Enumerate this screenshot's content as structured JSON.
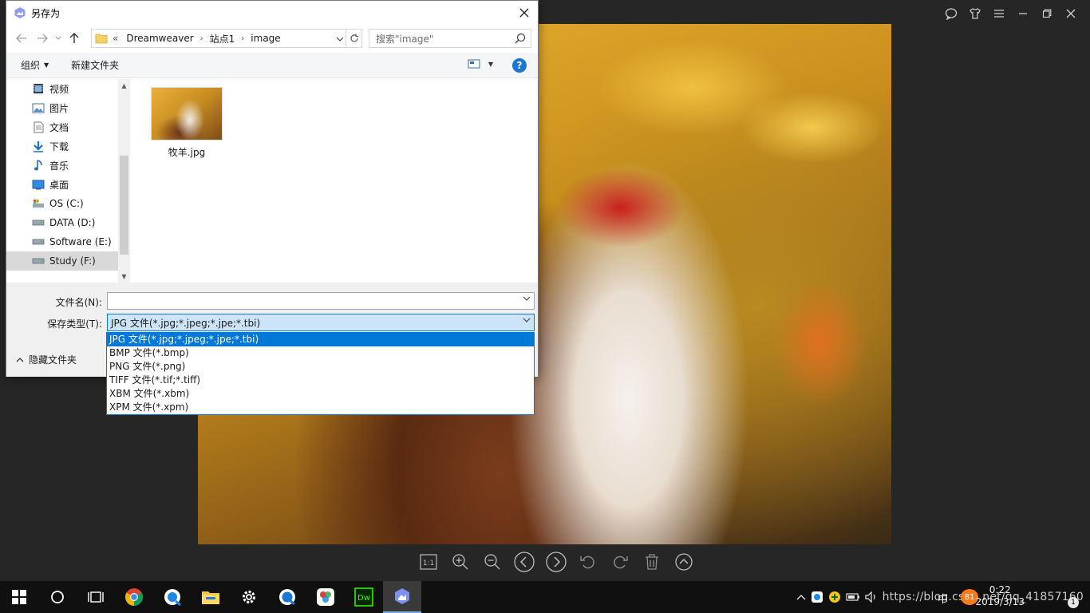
{
  "dialog": {
    "title": "另存为",
    "breadcrumb": {
      "overflow": "«",
      "items": [
        "Dreamweaver",
        "站点1",
        "image"
      ]
    },
    "search_placeholder": "搜索\"image\"",
    "commands": {
      "organize": "组织",
      "new_folder": "新建文件夹"
    },
    "help": "?",
    "nav_items": [
      {
        "label": "视频",
        "icon": "video-icon"
      },
      {
        "label": "图片",
        "icon": "pictures-icon"
      },
      {
        "label": "文档",
        "icon": "documents-icon"
      },
      {
        "label": "下载",
        "icon": "download-icon"
      },
      {
        "label": "音乐",
        "icon": "music-icon"
      },
      {
        "label": "桌面",
        "icon": "desktop-icon"
      },
      {
        "label": "OS (C:)",
        "icon": "drive-c-icon"
      },
      {
        "label": "DATA (D:)",
        "icon": "drive-icon"
      },
      {
        "label": "Software (E:)",
        "icon": "drive-icon"
      },
      {
        "label": "Study (F:)",
        "icon": "drive-icon",
        "selected": true
      }
    ],
    "files": [
      {
        "name": "牧羊.jpg"
      }
    ],
    "filename_label": "文件名(N):",
    "filename_value": "",
    "filetype_label": "保存类型(T):",
    "filetype_value": "JPG 文件(*.jpg;*.jpeg;*.jpe;*.tbi)",
    "filetype_options": [
      "JPG 文件(*.jpg;*.jpeg;*.jpe;*.tbi)",
      "BMP 文件(*.bmp)",
      "PNG 文件(*.png)",
      "TIFF 文件(*.tif;*.tiff)",
      "XBM 文件(*.xbm)",
      "XPM 文件(*.xpm)"
    ],
    "hide_folders": "隐藏文件夹"
  },
  "viewer": {
    "top_icons": [
      "chat-icon",
      "skin-icon",
      "menu-icon",
      "minimize-icon",
      "restore-icon",
      "close-icon"
    ],
    "tools": [
      "actual-size-icon",
      "zoom-in-icon",
      "zoom-out-icon",
      "previous-icon",
      "next-icon",
      "rotate-left-icon",
      "rotate-right-icon",
      "delete-icon",
      "collapse-icon"
    ],
    "actual_size_label": "1:1"
  },
  "taskbar": {
    "apps": [
      "start-icon",
      "cortana-icon",
      "task-view-icon",
      "chrome-icon",
      "browser-icon",
      "file-explorer-icon",
      "settings-icon",
      "edge-icon",
      "photo-app-icon",
      "dreamweaver-icon",
      "image-viewer-icon"
    ],
    "dw_label": "Dw",
    "tray_text": "https://blog.csdn.net/qq_41857160",
    "ime": "中",
    "badge": "81",
    "time": "0:22",
    "date": "2019/3/13",
    "notif_count": "1"
  }
}
